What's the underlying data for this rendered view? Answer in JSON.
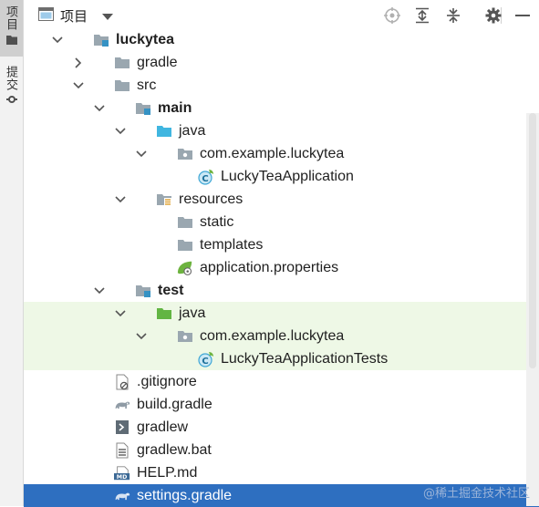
{
  "left_strip": {
    "tabs": [
      {
        "label": "项目",
        "icon": "folder-icon"
      },
      {
        "label": "提交",
        "icon": "commit-icon"
      }
    ]
  },
  "header": {
    "title": "项目",
    "actions": [
      "locate-icon",
      "expand-all-icon",
      "collapse-all-icon",
      "gear-icon",
      "minimize-icon"
    ]
  },
  "tree": [
    {
      "name": "luckytea",
      "indent": 0,
      "arrow": "down",
      "icon": "module-folder",
      "bold": true,
      "bg": ""
    },
    {
      "name": "gradle",
      "indent": 1,
      "arrow": "right",
      "icon": "folder",
      "bold": false,
      "bg": ""
    },
    {
      "name": "src",
      "indent": 1,
      "arrow": "down",
      "icon": "folder",
      "bold": false,
      "bg": ""
    },
    {
      "name": "main",
      "indent": 2,
      "arrow": "down",
      "icon": "module-folder",
      "bold": true,
      "bg": ""
    },
    {
      "name": "java",
      "indent": 3,
      "arrow": "down",
      "icon": "source-folder",
      "bold": false,
      "bg": ""
    },
    {
      "name": "com.example.luckytea",
      "indent": 4,
      "arrow": "down",
      "icon": "package",
      "bold": false,
      "bg": ""
    },
    {
      "name": "LuckyTeaApplication",
      "indent": 5,
      "arrow": "",
      "icon": "spring-class",
      "bold": false,
      "bg": ""
    },
    {
      "name": "resources",
      "indent": 3,
      "arrow": "down",
      "icon": "resources-folder",
      "bold": false,
      "bg": ""
    },
    {
      "name": "static",
      "indent": 4,
      "arrow": "",
      "icon": "folder",
      "bold": false,
      "bg": ""
    },
    {
      "name": "templates",
      "indent": 4,
      "arrow": "",
      "icon": "folder",
      "bold": false,
      "bg": ""
    },
    {
      "name": "application.properties",
      "indent": 4,
      "arrow": "",
      "icon": "spring-properties",
      "bold": false,
      "bg": ""
    },
    {
      "name": "test",
      "indent": 2,
      "arrow": "down",
      "icon": "module-folder",
      "bold": true,
      "bg": ""
    },
    {
      "name": "java",
      "indent": 3,
      "arrow": "down",
      "icon": "test-folder",
      "bold": false,
      "bg": "test"
    },
    {
      "name": "com.example.luckytea",
      "indent": 4,
      "arrow": "down",
      "icon": "package",
      "bold": false,
      "bg": "test"
    },
    {
      "name": "LuckyTeaApplicationTests",
      "indent": 5,
      "arrow": "",
      "icon": "spring-class",
      "bold": false,
      "bg": "test"
    },
    {
      "name": ".gitignore",
      "indent": 1,
      "arrow": "",
      "icon": "ignore-file",
      "bold": false,
      "bg": ""
    },
    {
      "name": "build.gradle",
      "indent": 1,
      "arrow": "",
      "icon": "gradle-file",
      "bold": false,
      "bg": ""
    },
    {
      "name": "gradlew",
      "indent": 1,
      "arrow": "",
      "icon": "shell-file",
      "bold": false,
      "bg": ""
    },
    {
      "name": "gradlew.bat",
      "indent": 1,
      "arrow": "",
      "icon": "text-file",
      "bold": false,
      "bg": ""
    },
    {
      "name": "HELP.md",
      "indent": 1,
      "arrow": "",
      "icon": "markdown-file",
      "bold": false,
      "bg": ""
    },
    {
      "name": "settings.gradle",
      "indent": 1,
      "arrow": "",
      "icon": "gradle-file",
      "bold": false,
      "bg": "selected"
    }
  ],
  "watermark": "@稀土掘金技术社区",
  "colors": {
    "selection": "#2e6fc0",
    "test_background": "#eef8e6",
    "folder": "#9aa7b0",
    "source_folder": "#40b6e0",
    "test_folder": "#62b543",
    "module_marker": "#3592c4",
    "spring": "#6db33f"
  }
}
